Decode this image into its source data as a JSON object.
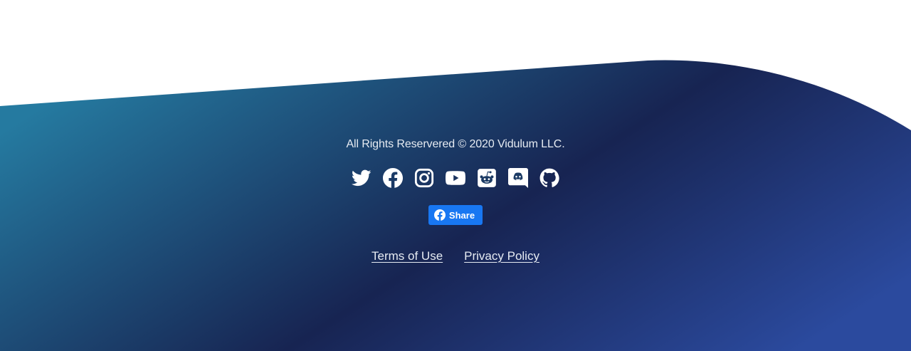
{
  "footer": {
    "copyright": "All Rights Reservered © 2020 Vidulum LLC.",
    "social": [
      {
        "name": "twitter-icon"
      },
      {
        "name": "facebook-icon"
      },
      {
        "name": "instagram-icon"
      },
      {
        "name": "youtube-icon"
      },
      {
        "name": "reddit-icon"
      },
      {
        "name": "discord-icon"
      },
      {
        "name": "github-icon"
      }
    ],
    "share_button_label": "Share",
    "links": {
      "terms": "Terms of Use",
      "privacy": "Privacy Policy"
    }
  },
  "colors": {
    "gradient_start": "#257aa0",
    "gradient_mid": "#172452",
    "gradient_end": "#2b4a9e",
    "facebook_blue": "#1877f2",
    "text": "#e6ebf2"
  }
}
